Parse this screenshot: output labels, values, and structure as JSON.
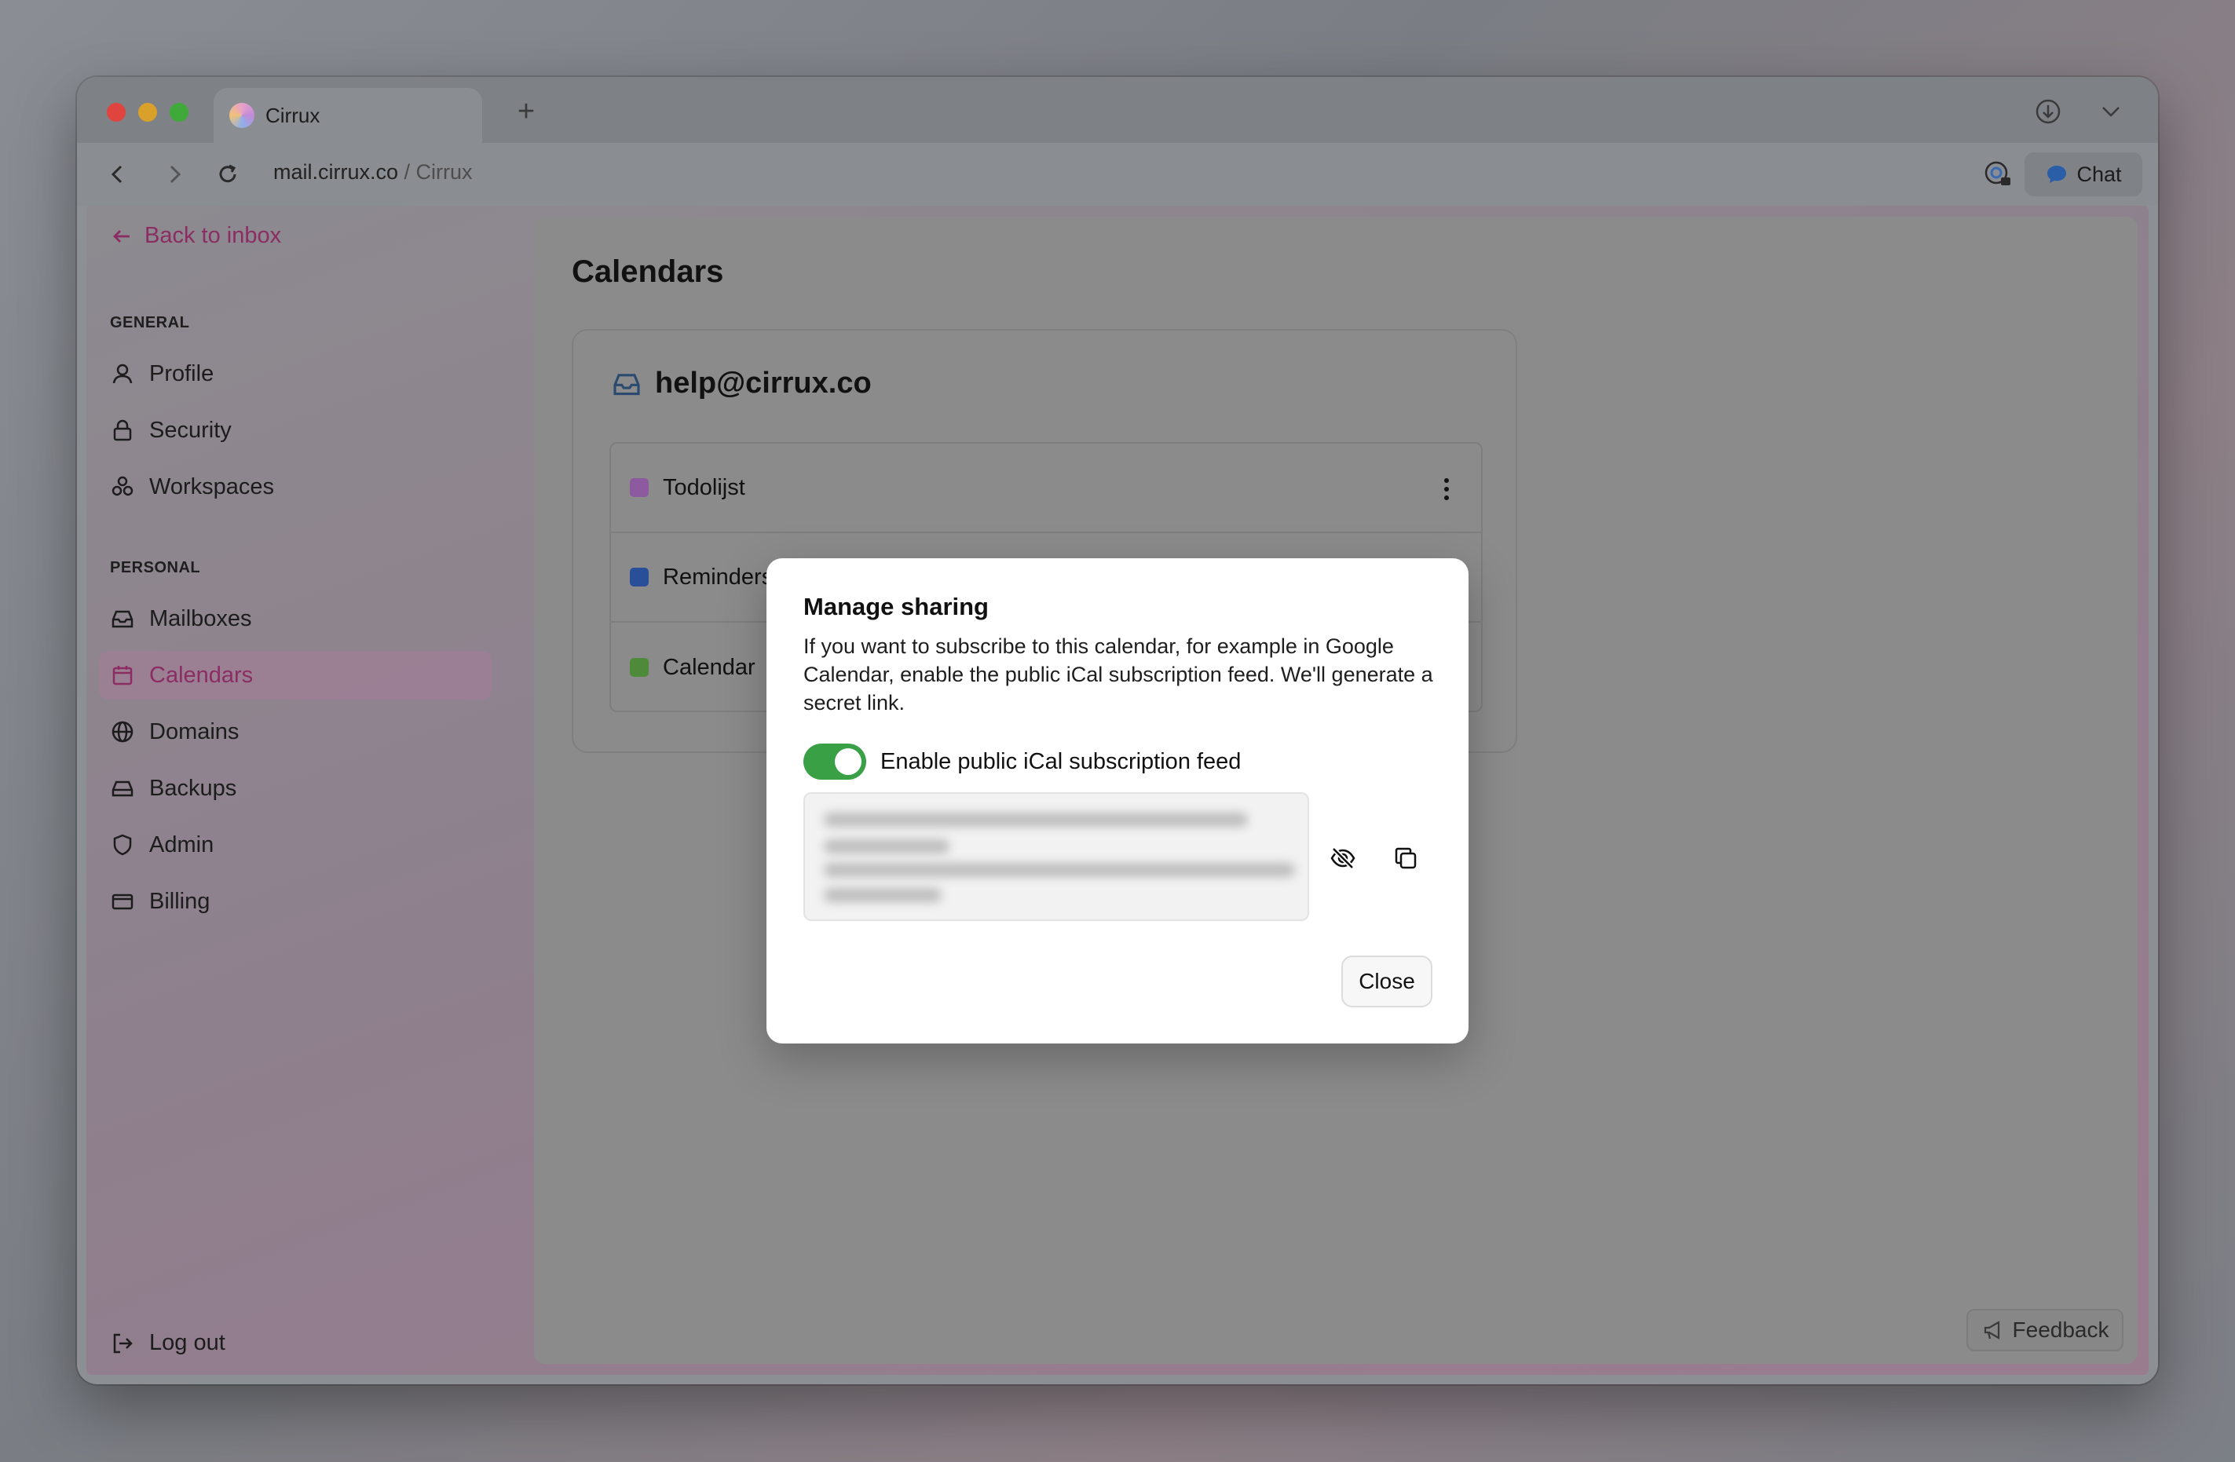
{
  "browser": {
    "tab_title": "Cirrux",
    "url_domain": "mail.cirrux.co",
    "url_separator": " / ",
    "url_site": "Cirrux",
    "chat_label": "Chat"
  },
  "sidebar": {
    "back_label": "Back to inbox",
    "general_label": "GENERAL",
    "general_items": [
      {
        "label": "Profile",
        "icon": "user-icon"
      },
      {
        "label": "Security",
        "icon": "lock-icon"
      },
      {
        "label": "Workspaces",
        "icon": "workspaces-icon"
      }
    ],
    "personal_label": "PERSONAL",
    "personal_items": [
      {
        "label": "Mailboxes",
        "icon": "inbox-icon"
      },
      {
        "label": "Calendars",
        "icon": "calendar-icon",
        "active": true
      },
      {
        "label": "Domains",
        "icon": "globe-icon"
      },
      {
        "label": "Backups",
        "icon": "drive-icon"
      },
      {
        "label": "Admin",
        "icon": "shield-icon"
      },
      {
        "label": "Billing",
        "icon": "credit-card-icon"
      }
    ],
    "logout_label": "Log out"
  },
  "main": {
    "title": "Calendars",
    "account": "help@cirrux.co",
    "calendars": [
      {
        "name": "Todolijst",
        "color": "#8e5a9f"
      },
      {
        "name": "Reminders",
        "color": "#2a4f99"
      },
      {
        "name": "Calendar",
        "color": "#4f8a3a"
      }
    ],
    "feedback_label": "Feedback"
  },
  "modal": {
    "title": "Manage sharing",
    "description": "If you want to subscribe to this calendar, for example in Google Calendar, enable the public iCal subscription feed. We'll generate a secret link.",
    "toggle_label": "Enable public iCal subscription feed",
    "toggle_on": true,
    "close_label": "Close"
  },
  "colors": {
    "accent": "#8b2d63",
    "toggle_on": "#39a046"
  }
}
